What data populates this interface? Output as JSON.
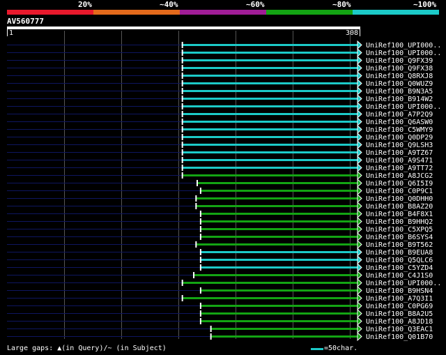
{
  "legend": {
    "labels": [
      "20%",
      "~40%",
      "~60%",
      "~80%",
      "~100%"
    ],
    "colors": [
      "#e8192c",
      "#e36a1c",
      "#a01d96",
      "#13a413",
      "#1ccac8"
    ]
  },
  "query": {
    "id": "AV560777",
    "start_label": "1",
    "end_label": "308",
    "length": 308
  },
  "colors": {
    "gap_line": "#0e1660",
    "grid_line": "#555555",
    "cyan": "#1ccac8",
    "green": "#13a413"
  },
  "hits": [
    {
      "id": "UniRef100_UPI000..",
      "start": 154,
      "end": 308,
      "color": "cyan"
    },
    {
      "id": "UniRef100_UPI000..",
      "start": 154,
      "end": 308,
      "color": "cyan"
    },
    {
      "id": "UniRef100_Q9FX39",
      "start": 154,
      "end": 308,
      "color": "cyan"
    },
    {
      "id": "UniRef100_Q9FX38",
      "start": 154,
      "end": 308,
      "color": "cyan"
    },
    {
      "id": "UniRef100_Q8RXJ8",
      "start": 154,
      "end": 308,
      "color": "cyan"
    },
    {
      "id": "UniRef100_Q0WUZ9",
      "start": 154,
      "end": 308,
      "color": "cyan"
    },
    {
      "id": "UniRef100_B9N3A5",
      "start": 154,
      "end": 308,
      "color": "cyan"
    },
    {
      "id": "UniRef100_B914W2",
      "start": 154,
      "end": 308,
      "color": "cyan"
    },
    {
      "id": "UniRef100_UPI000..",
      "start": 154,
      "end": 308,
      "color": "cyan"
    },
    {
      "id": "UniRef100_A7P2Q9",
      "start": 154,
      "end": 308,
      "color": "cyan"
    },
    {
      "id": "UniRef100_Q6ASW0",
      "start": 154,
      "end": 308,
      "color": "cyan"
    },
    {
      "id": "UniRef100_C5WMY9",
      "start": 154,
      "end": 308,
      "color": "cyan"
    },
    {
      "id": "UniRef100_Q0DP29",
      "start": 154,
      "end": 308,
      "color": "cyan"
    },
    {
      "id": "UniRef100_Q9LSH3",
      "start": 154,
      "end": 308,
      "color": "cyan"
    },
    {
      "id": "UniRef100_A9TZ67",
      "start": 154,
      "end": 308,
      "color": "cyan"
    },
    {
      "id": "UniRef100_A9S471",
      "start": 154,
      "end": 308,
      "color": "cyan"
    },
    {
      "id": "UniRef100_A9TT72",
      "start": 154,
      "end": 308,
      "color": "cyan"
    },
    {
      "id": "UniRef100_A8JCG2",
      "start": 154,
      "end": 308,
      "color": "green"
    },
    {
      "id": "UniRef100_Q6I5I9",
      "start": 167,
      "end": 308,
      "color": "green"
    },
    {
      "id": "UniRef100_C0P9C1",
      "start": 170,
      "end": 308,
      "color": "green"
    },
    {
      "id": "UniRef100_Q0DHH0",
      "start": 166,
      "end": 308,
      "color": "green"
    },
    {
      "id": "UniRef100_B8AZ20",
      "start": 166,
      "end": 308,
      "color": "green"
    },
    {
      "id": "UniRef100_B4F8X1",
      "start": 170,
      "end": 308,
      "color": "green"
    },
    {
      "id": "UniRef100_B9HHQ2",
      "start": 170,
      "end": 308,
      "color": "green"
    },
    {
      "id": "UniRef100_C5XPQ5",
      "start": 170,
      "end": 308,
      "color": "green"
    },
    {
      "id": "UniRef100_B6SYS4",
      "start": 170,
      "end": 308,
      "color": "green"
    },
    {
      "id": "UniRef100_B9T562",
      "start": 166,
      "end": 308,
      "color": "green"
    },
    {
      "id": "UniRef100_B9EUA8",
      "start": 170,
      "end": 308,
      "color": "cyan"
    },
    {
      "id": "UniRef100_Q5QLC6",
      "start": 170,
      "end": 308,
      "color": "cyan"
    },
    {
      "id": "UniRef100_C5YZD4",
      "start": 170,
      "end": 308,
      "color": "cyan"
    },
    {
      "id": "UniRef100_C4J1S0",
      "start": 164,
      "end": 308,
      "color": "green"
    },
    {
      "id": "UniRef100_UPI000..",
      "start": 154,
      "end": 308,
      "color": "green"
    },
    {
      "id": "UniRef100_B9HSN4",
      "start": 170,
      "end": 308,
      "color": "green"
    },
    {
      "id": "UniRef100_A7Q3I1",
      "start": 154,
      "end": 308,
      "color": "green"
    },
    {
      "id": "UniRef100_C0PG69",
      "start": 170,
      "end": 308,
      "color": "green"
    },
    {
      "id": "UniRef100_B8A2U5",
      "start": 170,
      "end": 308,
      "color": "green"
    },
    {
      "id": "UniRef100_A8JD18",
      "start": 170,
      "end": 308,
      "color": "green"
    },
    {
      "id": "UniRef100_Q3EAC1",
      "start": 179,
      "end": 308,
      "color": "green"
    },
    {
      "id": "UniRef100_Q01B70",
      "start": 179,
      "end": 308,
      "color": "green"
    }
  ],
  "footer": {
    "gaps_text": "Large gaps: ▲(in Query)/~ (in Subject)",
    "scale_text": "=50char."
  }
}
